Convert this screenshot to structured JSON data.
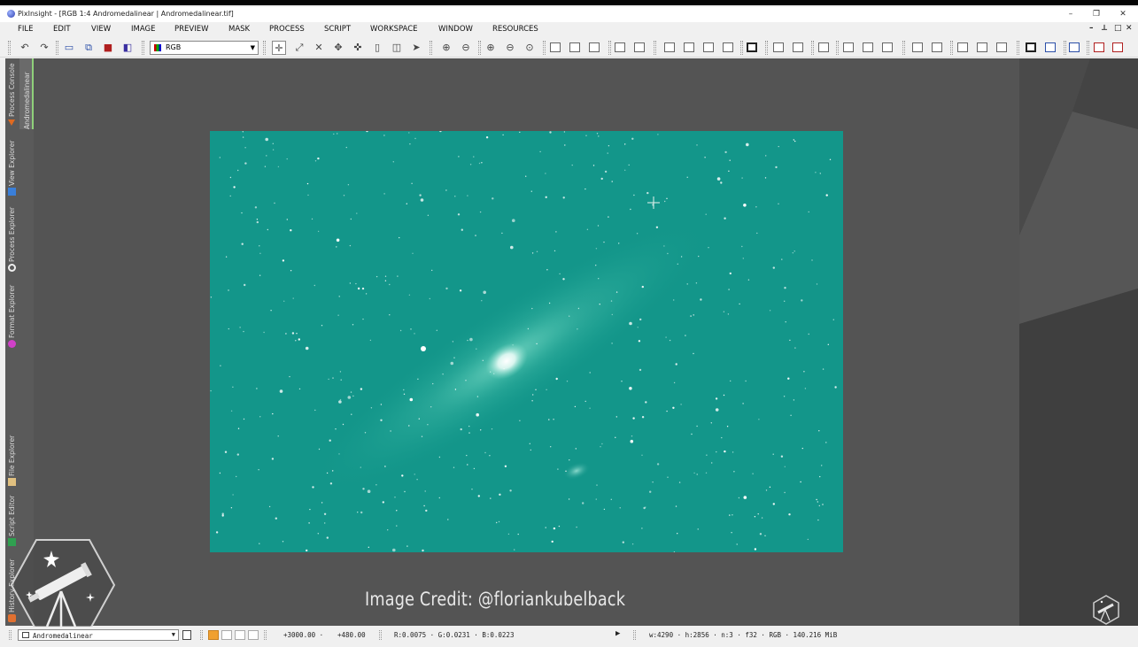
{
  "window": {
    "title": "PixInsight - [RGB 1:4 Andromedalinear | Andromedalinear.tif]",
    "minimize": "–",
    "restore": "❐",
    "close": "✕"
  },
  "menu": {
    "items": [
      "FILE",
      "EDIT",
      "VIEW",
      "IMAGE",
      "PREVIEW",
      "MASK",
      "PROCESS",
      "SCRIPT",
      "WORKSPACE",
      "WINDOW",
      "RESOURCES"
    ],
    "mdi_controls": [
      "–",
      "⟂",
      "□",
      "✕"
    ]
  },
  "toolbar": {
    "channel_value": "RGB",
    "icons": [
      "undo-icon",
      "redo-icon",
      "preview-icon",
      "new-instance-icon",
      "rgb-channels-icon",
      "color-calibration-icon",
      "readout-icon",
      "zoom-to-fit-icon",
      "fit-view-icon",
      "pan-icon",
      "center-icon",
      "select-icon",
      "zoom-in-icon",
      "zoom-out-icon",
      "zoom-1-1-icon",
      "zoom-in-alt-icon",
      "zoom-out-alt-icon"
    ]
  },
  "side_tabs": [
    "Andromedalinear",
    "Process Console",
    "View Explorer",
    "Process Explorer",
    "Format Explorer",
    "File Explorer",
    "Script Editor",
    "History Explorer"
  ],
  "image": {
    "view_id": "Andromedalinear",
    "background_color": "#13968a",
    "galaxy_core_color": "#ffffff"
  },
  "credit": {
    "text": "Image Credit: @floriankubelback"
  },
  "status": {
    "view_id": "Andromedalinear",
    "x_coord": "+3000.00 ·",
    "y_coord": "+480.00",
    "readout": "R:0.0075 · G:0.0231 · B:0.0223",
    "image_info": "w:4290 · h:2856 · n:3 · f32 · RGB · 140.216 MiB",
    "accent_color": "#f0a030"
  }
}
